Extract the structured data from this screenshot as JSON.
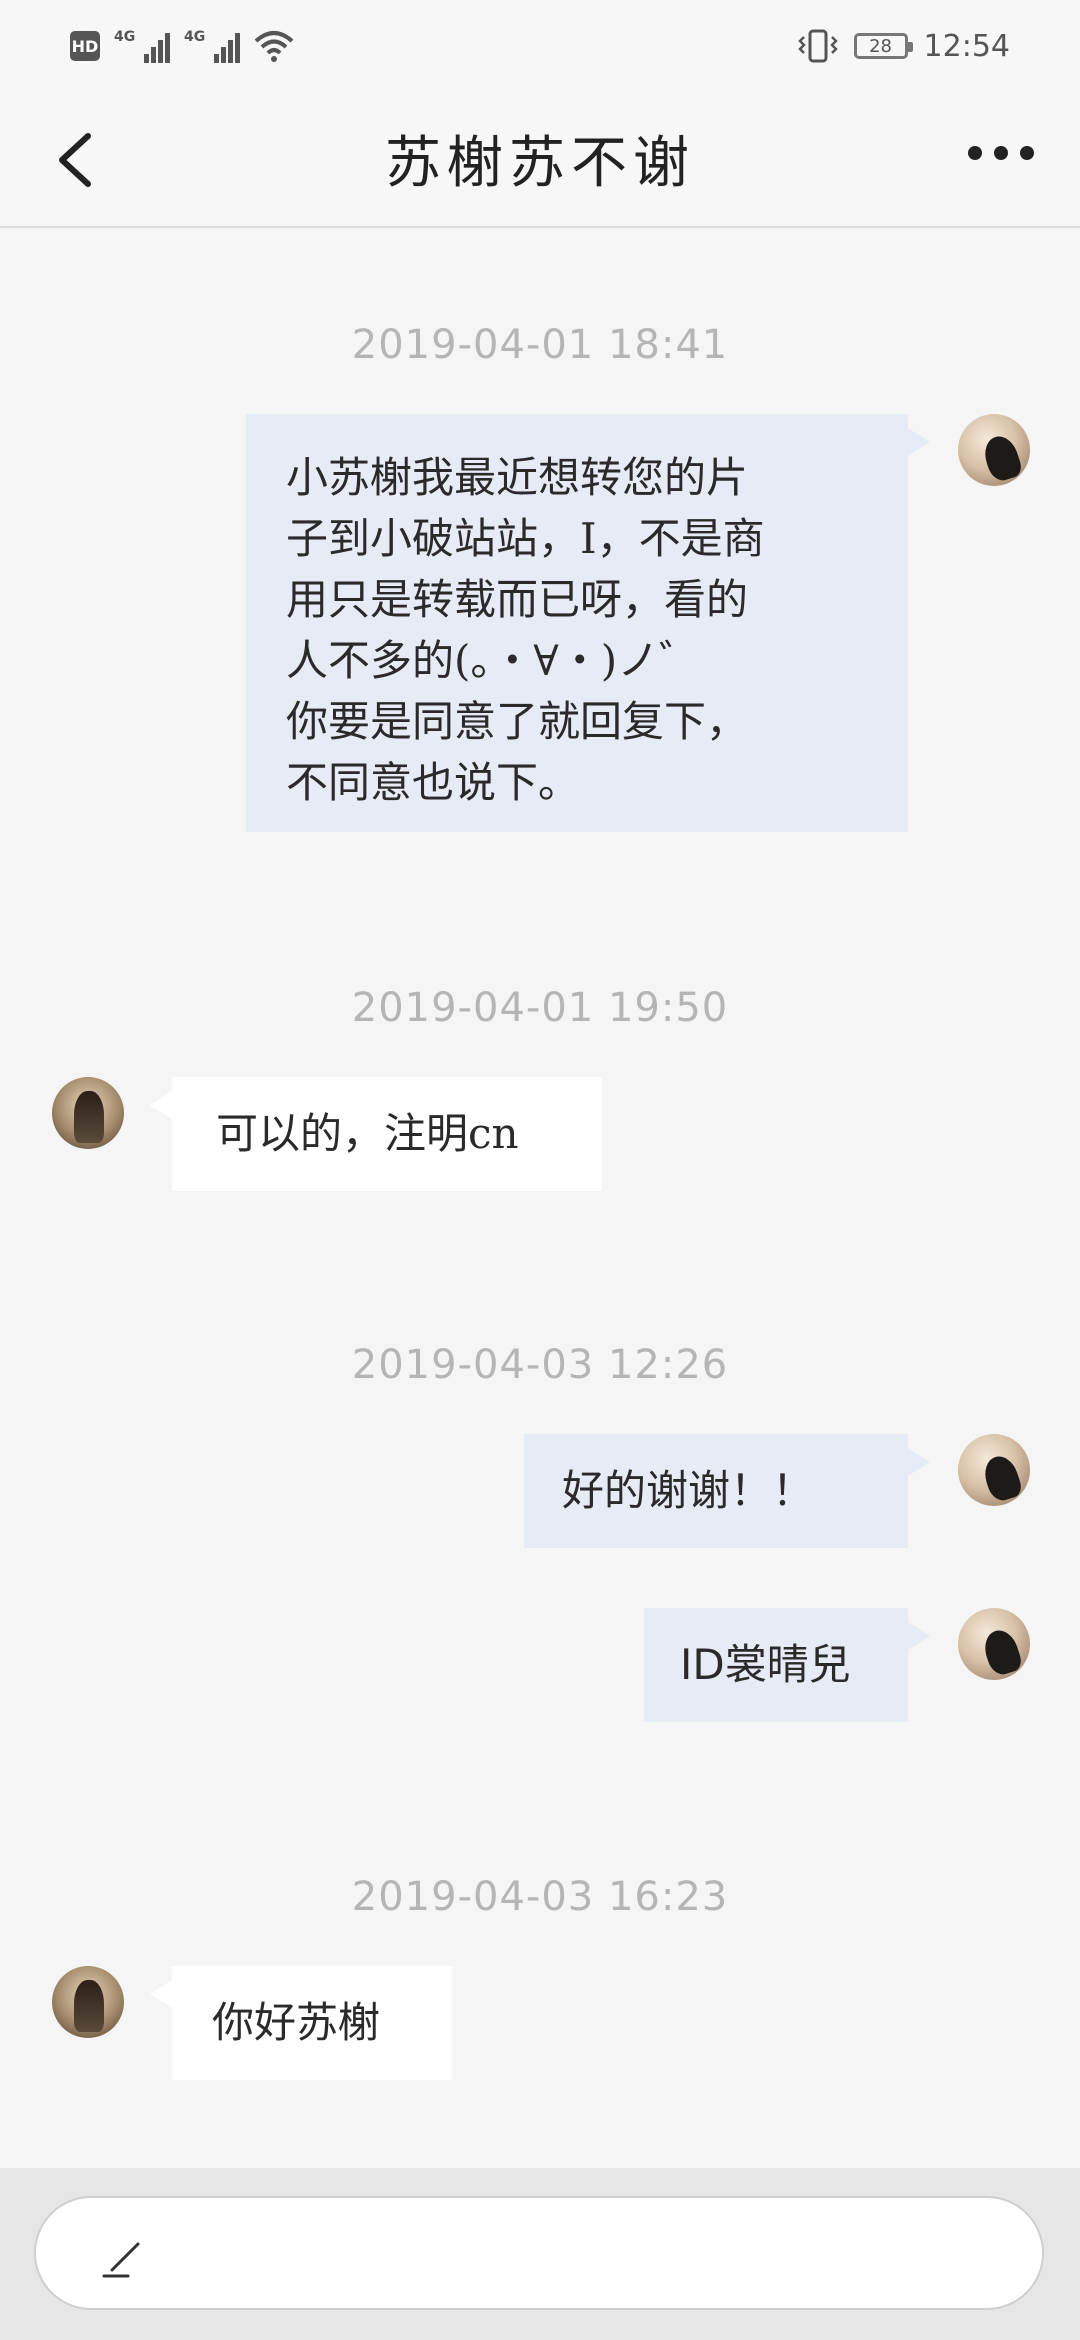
{
  "status_bar": {
    "hd_label": "HD",
    "sim1_label": "4G",
    "sim2_label": "4G",
    "battery": "28",
    "time": "12:54"
  },
  "header": {
    "title": "苏榭苏不谢"
  },
  "messages": [
    {
      "timestamp": "2019-04-01 18:41",
      "from": "me",
      "lines": [
        "小苏榭我最近想转您的片",
        "子到小破站站，I，不是商",
        "用只是转载而已呀，看的",
        "人不多的(。・∀・)ノ゛",
        "你要是同意了就回复下，",
        "不同意也说下。"
      ]
    },
    {
      "timestamp": "2019-04-01 19:50",
      "from": "other",
      "lines": [
        "可以的，注明cn"
      ]
    },
    {
      "timestamp": "2019-04-03 12:26",
      "from": "me",
      "lines": [
        "好的谢谢！！"
      ]
    },
    {
      "timestamp": "",
      "from": "me",
      "lines": [
        "ID裳晴兒"
      ]
    },
    {
      "timestamp": "2019-04-03 16:23",
      "from": "other",
      "lines": [
        "你好苏榭"
      ]
    }
  ],
  "input": {
    "placeholder": ""
  },
  "colors": {
    "my_bubble": "#e7ebf6",
    "their_bubble": "#ffffff",
    "background": "#f5f5f5",
    "timestamp": "#b5b5b5"
  },
  "icons": [
    "back-arrow-icon",
    "more-icon",
    "pen-icon",
    "wifi-icon",
    "vibrate-icon"
  ]
}
